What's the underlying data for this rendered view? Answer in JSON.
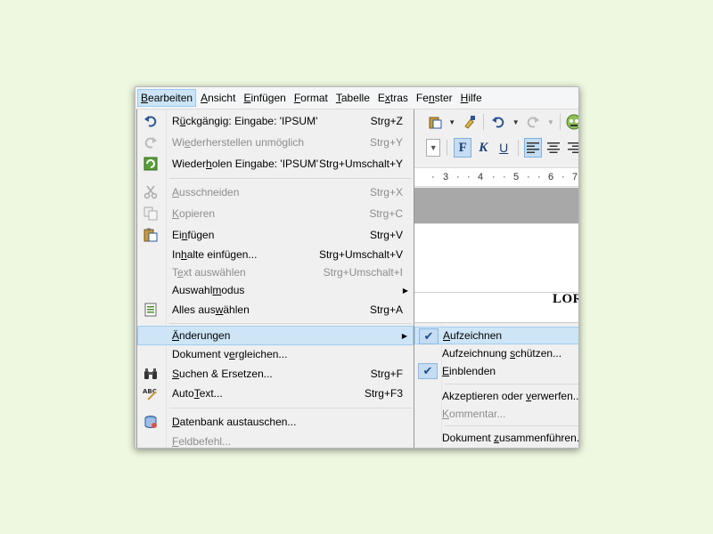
{
  "menubar": {
    "items": [
      {
        "pre": "",
        "mn": "B",
        "post": "earbeiten"
      },
      {
        "pre": "",
        "mn": "A",
        "post": "nsicht"
      },
      {
        "pre": "",
        "mn": "E",
        "post": "infügen"
      },
      {
        "pre": "",
        "mn": "F",
        "post": "ormat"
      },
      {
        "pre": "",
        "mn": "T",
        "post": "abelle"
      },
      {
        "pre": "E",
        "mn": "x",
        "post": "tras"
      },
      {
        "pre": "Fe",
        "mn": "n",
        "post": "ster"
      },
      {
        "pre": "",
        "mn": "H",
        "post": "ilfe"
      }
    ]
  },
  "format_toolbar": {
    "bold": "F",
    "italic": "K",
    "underline": "U"
  },
  "ruler": {
    "ticks": [
      "3",
      "4",
      "5",
      "6",
      "7"
    ]
  },
  "document": {
    "text": "LOR"
  },
  "edit_menu": {
    "items": [
      {
        "pre": "R",
        "mn": "ü",
        "post": "ckgängig: Eingabe: 'IPSUM'",
        "shortcut": "Strg+Z"
      },
      {
        "pre": "Wi",
        "mn": "e",
        "post": "derherstellen unmöglich",
        "shortcut": "Strg+Y"
      },
      {
        "pre": "Wieder",
        "mn": "h",
        "post": "olen Eingabe: 'IPSUM'",
        "shortcut": "Strg+Umschalt+Y"
      },
      {
        "pre": "",
        "mn": "A",
        "post": "usschneiden",
        "shortcut": "Strg+X"
      },
      {
        "pre": "",
        "mn": "K",
        "post": "opieren",
        "shortcut": "Strg+C"
      },
      {
        "pre": "Ei",
        "mn": "n",
        "post": "fügen",
        "shortcut": "Strg+V"
      },
      {
        "pre": "In",
        "mn": "h",
        "post": "alte einfügen...",
        "shortcut": "Strg+Umschalt+V"
      },
      {
        "pre": "T",
        "mn": "e",
        "post": "xt auswählen",
        "shortcut": "Strg+Umschalt+I"
      },
      {
        "pre": "Auswahl",
        "mn": "m",
        "post": "odus",
        "shortcut": ""
      },
      {
        "pre": "Alles aus",
        "mn": "w",
        "post": "ählen",
        "shortcut": "Strg+A"
      },
      {
        "pre": "",
        "mn": "Ä",
        "post": "nderungen",
        "shortcut": ""
      },
      {
        "pre": "Dokument v",
        "mn": "e",
        "post": "rgleichen...",
        "shortcut": ""
      },
      {
        "pre": "",
        "mn": "S",
        "post": "uchen & Ersetzen...",
        "shortcut": "Strg+F"
      },
      {
        "pre": "Auto",
        "mn": "T",
        "post": "ext...",
        "shortcut": "Strg+F3"
      },
      {
        "pre": "",
        "mn": "D",
        "post": "atenbank austauschen...",
        "shortcut": ""
      },
      {
        "pre": "",
        "mn": "F",
        "post": "eldbefehl...",
        "shortcut": ""
      }
    ]
  },
  "changes_submenu": {
    "items": [
      {
        "pre": "",
        "mn": "A",
        "post": "ufzeichnen"
      },
      {
        "pre": "Aufzeichnung ",
        "mn": "s",
        "post": "chützen..."
      },
      {
        "pre": "",
        "mn": "E",
        "post": "inblenden"
      },
      {
        "pre": "Akzeptieren oder ",
        "mn": "v",
        "post": "erwerfen..."
      },
      {
        "pre": "",
        "mn": "K",
        "post": "ommentar..."
      },
      {
        "pre": "Dokument ",
        "mn": "z",
        "post": "usammenführen..."
      }
    ]
  }
}
